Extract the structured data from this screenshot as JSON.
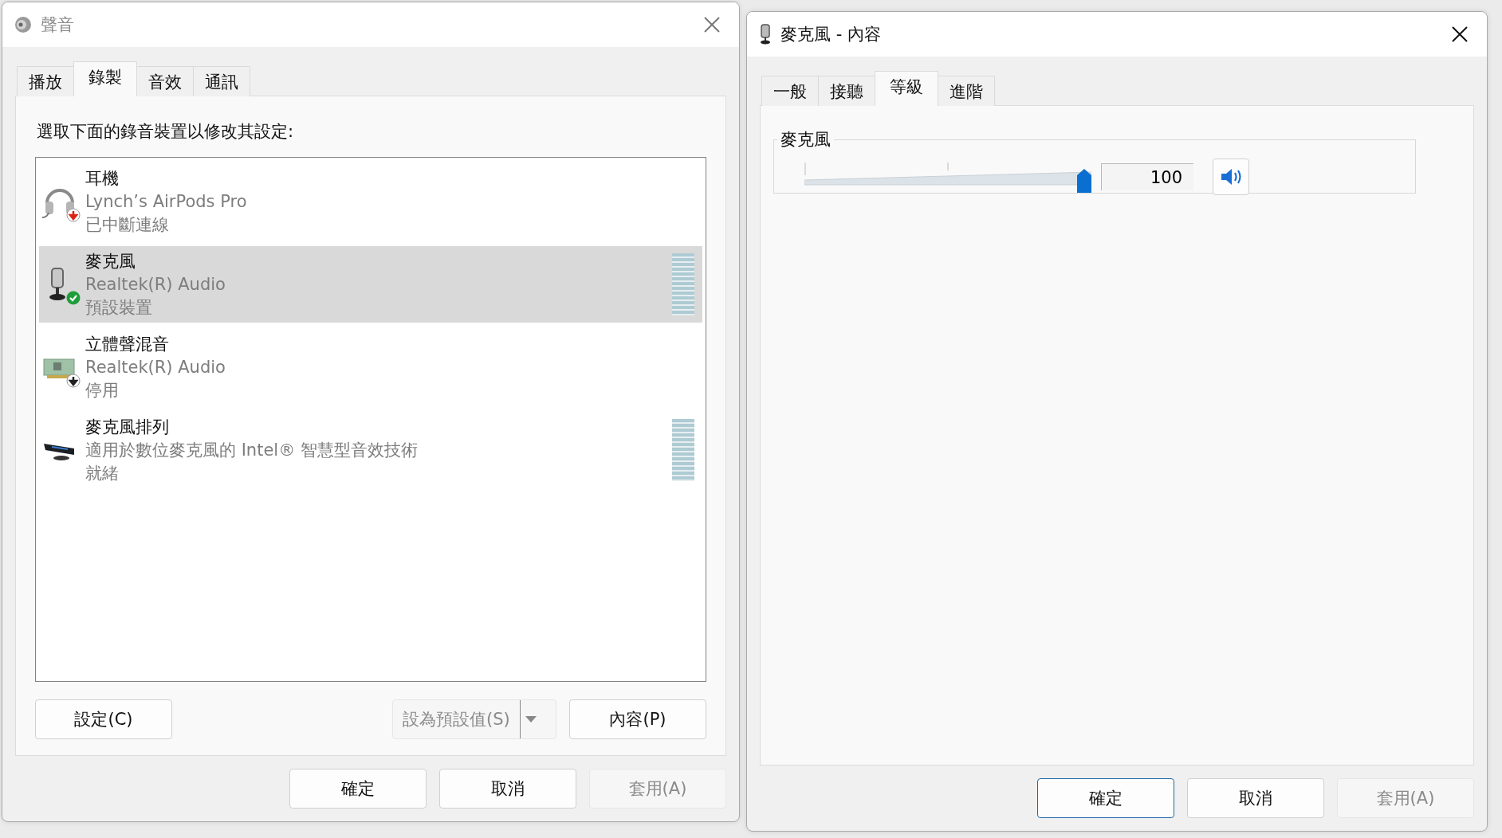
{
  "sound_window": {
    "title": "聲音",
    "active": false,
    "tabs": [
      {
        "label": "播放",
        "selected": false
      },
      {
        "label": "錄製",
        "selected": true
      },
      {
        "label": "音效",
        "selected": false
      },
      {
        "label": "通訊",
        "selected": false
      }
    ],
    "instruction": "選取下面的錄音裝置以修改其設定:",
    "devices": [
      {
        "kind": "headset",
        "name": "耳機",
        "description": "Lynch’s AirPods Pro",
        "status": "已中斷連線",
        "badge": {
          "kind": "disconnected"
        },
        "selected": false,
        "meter": false
      },
      {
        "kind": "microphone",
        "name": "麥克風",
        "description": "Realtek(R) Audio",
        "status": "預設裝置",
        "badge": {
          "kind": "default"
        },
        "selected": true,
        "meter": true
      },
      {
        "kind": "mixer",
        "name": "立體聲混音",
        "description": "Realtek(R) Audio",
        "status": "停用",
        "badge": {
          "kind": "disabled"
        },
        "selected": false,
        "meter": false
      },
      {
        "kind": "array",
        "name": "麥克風排列",
        "description": "適用於數位麥克風的 Intel® 智慧型音效技術",
        "status": "就緒",
        "selected": false,
        "meter": true
      }
    ],
    "buttons": [
      {
        "kind": "plain",
        "label": "設定(C)",
        "disabled": false
      },
      {
        "kind": "split",
        "label": "設為預設值(S)",
        "disabled": true
      },
      {
        "kind": "plain",
        "label": "內容(P)",
        "disabled": false
      }
    ],
    "footer_buttons": [
      {
        "label": "確定",
        "disabled": false,
        "default": false
      },
      {
        "label": "取消",
        "disabled": false,
        "default": false
      },
      {
        "label": "套用(A)",
        "disabled": true,
        "default": false
      }
    ]
  },
  "properties_window": {
    "title": "麥克風 - 內容",
    "active": true,
    "tabs": [
      {
        "label": "一般",
        "selected": false
      },
      {
        "label": "接聽",
        "selected": false
      },
      {
        "label": "等級",
        "selected": true
      },
      {
        "label": "進階",
        "selected": false
      }
    ],
    "level_group": {
      "label": "麥克風",
      "level": 1,
      "value": "100",
      "muted": false
    },
    "footer_buttons": [
      {
        "label": "確定",
        "disabled": false,
        "default": true
      },
      {
        "label": "取消",
        "disabled": false,
        "default": false
      },
      {
        "label": "套用(A)",
        "disabled": true,
        "default": false
      }
    ]
  }
}
